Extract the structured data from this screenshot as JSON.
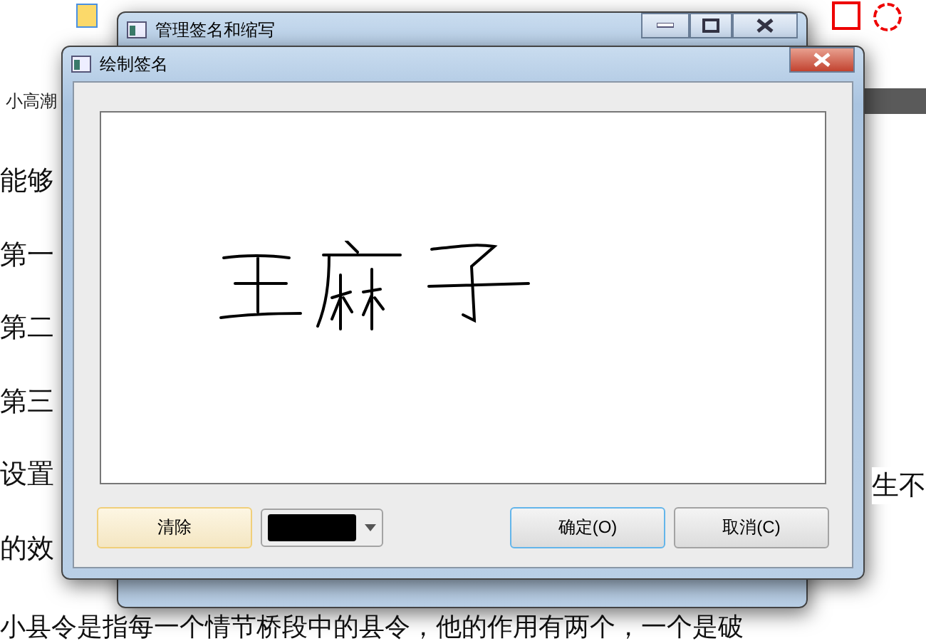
{
  "document": {
    "tab": "小高潮",
    "lines": [
      "能够",
      "第一",
      "第二",
      "第三",
      "设置",
      "的效"
    ],
    "side_text": "生不",
    "bottom_line": "小县令是指每一个情节桥段中的县令，他的作用有两个，一个是破"
  },
  "back_window": {
    "title": "管理签名和缩写"
  },
  "dialog": {
    "title": "绘制签名",
    "buttons": [
      {
        "label": "清除",
        "kind": "hover"
      },
      {
        "label": "确定(O)",
        "kind": "default"
      },
      {
        "label": "取消(C)",
        "kind": "normal"
      }
    ]
  }
}
